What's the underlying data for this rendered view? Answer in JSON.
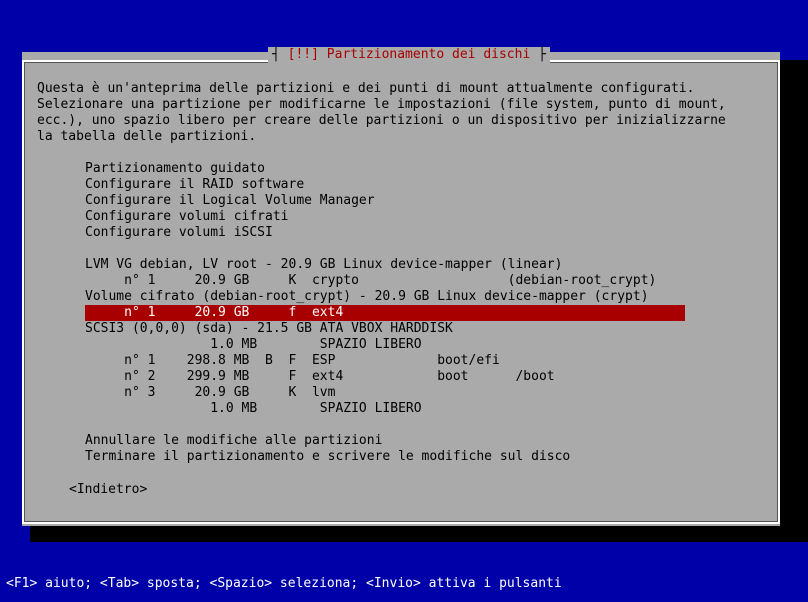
{
  "dialog": {
    "title": "[!!] Partizionamento dei dischi",
    "intro_lines": [
      "Questa è un'anteprima delle partizioni e dei punti di mount attualmente configurati.",
      "Selezionare una partizione per modificarne le impostazioni (file system, punto di mount,",
      "ecc.), uno spazio libero per creare delle partizioni o un dispositivo per inizializzarne",
      "la tabella delle partizioni."
    ],
    "guided": [
      "Partizionamento guidato",
      "Configurare il RAID software",
      "Configurare il Logical Volume Manager",
      "Configurare volumi cifrati",
      "Configurare volumi iSCSI"
    ],
    "devices": [
      "LVM VG debian, LV root - 20.9 GB Linux device-mapper (linear)",
      "     n° 1     20.9 GB     K  crypto                   (debian-root_crypt)",
      "Volume cifrato (debian-root_crypt) - 20.9 GB Linux device-mapper (crypt)",
      "     n° 1     20.9 GB     f  ext4",
      "SCSI3 (0,0,0) (sda) - 21.5 GB ATA VBOX HARDDISK",
      "                1.0 MB        SPAZIO LIBERO",
      "     n° 1    298.8 MB  B  F  ESP             boot/efi",
      "     n° 2    299.9 MB     F  ext4            boot      /boot",
      "     n° 3     20.9 GB     K  lvm",
      "                1.0 MB        SPAZIO LIBERO"
    ],
    "selected_device_index": 3,
    "finish": [
      "Annullare le modifiche alle partizioni",
      "Terminare il partizionamento e scrivere le modifiche sul disco"
    ],
    "back_label": "<Indietro>"
  },
  "status_bar": "<F1> aiuto; <Tab> sposta; <Spazio> seleziona; <Invio> attiva i pulsanti",
  "colors": {
    "background": "#0000a8",
    "dialog": "#aaaaaa",
    "title": "#a80000",
    "selection": "#a80000"
  }
}
